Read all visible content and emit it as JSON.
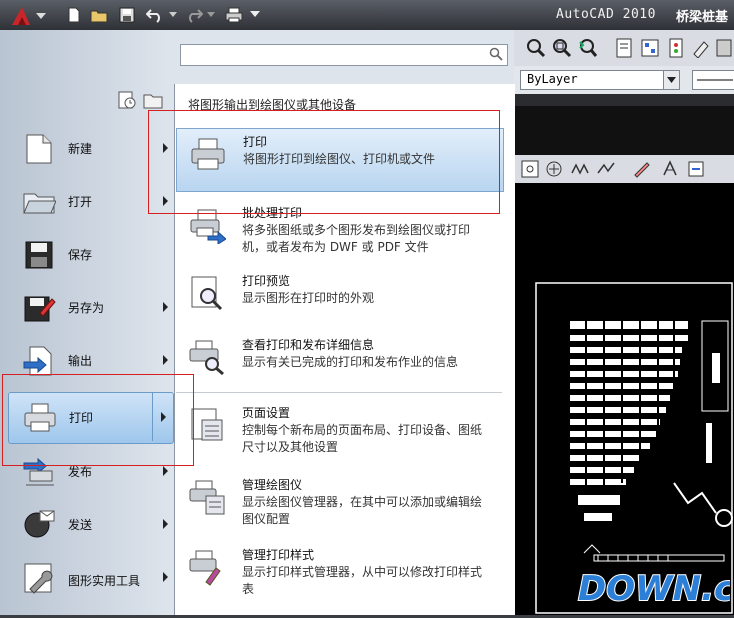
{
  "window": {
    "app_title": "AutoCAD 2010",
    "doc_title": "桥梁桩基"
  },
  "search": {
    "placeholder": ""
  },
  "linetype": {
    "value": "ByLayer"
  },
  "menu": {
    "commands": [
      {
        "id": "new",
        "label": "新建",
        "has_submenu": true
      },
      {
        "id": "open",
        "label": "打开",
        "has_submenu": true
      },
      {
        "id": "save",
        "label": "保存",
        "has_submenu": false
      },
      {
        "id": "saveas",
        "label": "另存为",
        "has_submenu": true
      },
      {
        "id": "export",
        "label": "输出",
        "has_submenu": true
      },
      {
        "id": "print",
        "label": "打印",
        "has_submenu": true,
        "selected": true
      },
      {
        "id": "publish",
        "label": "发布",
        "has_submenu": true
      },
      {
        "id": "send",
        "label": "发送",
        "has_submenu": true
      },
      {
        "id": "utilities",
        "label": "图形实用工具",
        "has_submenu": true
      }
    ]
  },
  "submenu": {
    "header": "将图形输出到绘图仪或其他设备",
    "items": [
      {
        "title": "打印",
        "desc": "将图形打印到绘图仪、打印机或文件"
      },
      {
        "title": "批处理打印",
        "desc": "将多张图纸或多个图形发布到绘图仪或打印机，或者发布为 DWF 或 PDF 文件"
      },
      {
        "title": "打印预览",
        "desc": "显示图形在打印时的外观"
      },
      {
        "title": "查看打印和发布详细信息",
        "desc": "显示有关已完成的打印和发布作业的信息"
      },
      {
        "title": "页面设置",
        "desc": "控制每个新布局的页面布局、打印设备、图纸尺寸以及其他设置"
      },
      {
        "title": "管理绘图仪",
        "desc": "显示绘图仪管理器，在其中可以添加或编辑绘图仪配置"
      },
      {
        "title": "管理打印样式",
        "desc": "显示打印样式管理器，从中可以修改打印样式表"
      }
    ]
  },
  "watermark": {
    "text": "DOWN.cc"
  },
  "colors": {
    "highlight": "#9fc7ec",
    "annotation": "#d62020",
    "canvas": "#000000"
  }
}
